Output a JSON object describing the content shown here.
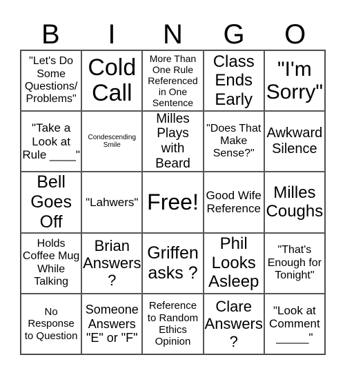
{
  "header": {
    "letters": [
      "B",
      "I",
      "N",
      "G",
      "O"
    ]
  },
  "cells": [
    "\"Let's Do Some Questions/ Problems\"",
    "Cold Call",
    "More Than One Rule Referenced in One Sentence",
    "Class Ends Early",
    "\"I'm Sorry\"",
    "\"Take a Look at Rule ____\"",
    "Condescending Smile",
    "Milles Plays with Beard",
    "\"Does That Make Sense?\"",
    "Awkward Silence",
    "Bell Goes Off",
    "\"Lahwers\"",
    "Free!",
    "Good Wife Reference",
    "Milles Coughs",
    "Holds Coffee Mug While Talking",
    "Brian Answers ?",
    "Griffen asks ?",
    "Phil Looks Asleep",
    "\"That's Enough for Tonight\"",
    "No Response to Question",
    "Someone Answers \"E\" or \"F\"",
    "Reference to Random Ethics Opinion",
    "Clare Answers ?",
    "\"Look at Comment _____\""
  ]
}
